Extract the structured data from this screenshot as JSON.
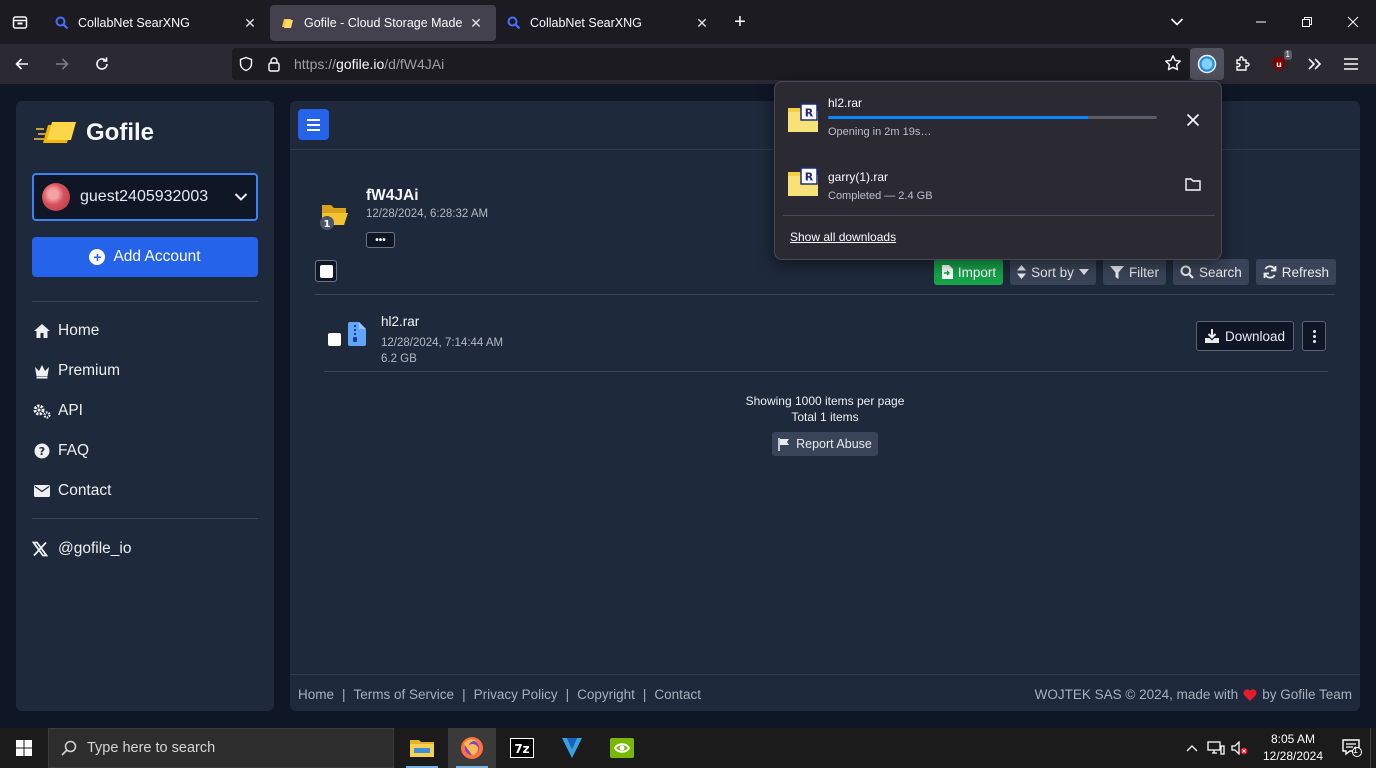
{
  "browser": {
    "tabs": [
      {
        "title": "CollabNet SearXNG",
        "active": false,
        "favicon": "search-icon"
      },
      {
        "title": "Gofile - Cloud Storage Made Simple",
        "active": true,
        "favicon": "gofile-icon"
      },
      {
        "title": "CollabNet SearXNG",
        "active": false,
        "favicon": "search-icon"
      }
    ],
    "url_prefix": "https://",
    "url_domain": "gofile.io",
    "url_path": "/d/fW4JAi",
    "extension_badge": "1"
  },
  "downloads_panel": {
    "items": [
      {
        "name": "hl2.rar",
        "status": "Opening in 2m 19s…",
        "progress": 0.79
      },
      {
        "name": "garry(1).rar",
        "status": "Completed — 2.4 GB"
      }
    ],
    "show_all": "Show all downloads"
  },
  "sidebar": {
    "brand": "Gofile",
    "account": "guest2405932003",
    "add_account": "Add Account",
    "menu": [
      {
        "label": "Home",
        "icon": "home-icon"
      },
      {
        "label": "Premium",
        "icon": "crown-icon"
      },
      {
        "label": "API",
        "icon": "gears-icon"
      },
      {
        "label": "FAQ",
        "icon": "question-icon"
      },
      {
        "label": "Contact",
        "icon": "envelope-icon"
      }
    ],
    "social": "@gofile_io"
  },
  "main": {
    "folder": {
      "name": "fW4JAi",
      "date": "12/28/2024, 6:28:32 AM",
      "badge": "1",
      "more": "•••"
    },
    "actions": {
      "import": "Import",
      "sort": "Sort by",
      "filter": "Filter",
      "search": "Search",
      "refresh": "Refresh"
    },
    "files": [
      {
        "name": "hl2.rar",
        "date": "12/28/2024, 7:14:44 AM",
        "size": "6.2 GB",
        "download": "Download"
      }
    ],
    "pager_line1": "Showing 1000 items per page",
    "pager_line2": "Total 1 items",
    "report": "Report Abuse",
    "footer_links": [
      "Home",
      "Terms of Service",
      "Privacy Policy",
      "Copyright",
      "Contact"
    ],
    "footer_left": "WOJTEK SAS © 2024, made with",
    "footer_right": "by Gofile Team"
  },
  "taskbar": {
    "search_placeholder": "Type here to search",
    "time": "8:05 AM",
    "date": "12/28/2024",
    "notification_count": "1",
    "colors": {
      "firefox_accent": "#ff7139",
      "nvidia": "#76b900"
    }
  }
}
